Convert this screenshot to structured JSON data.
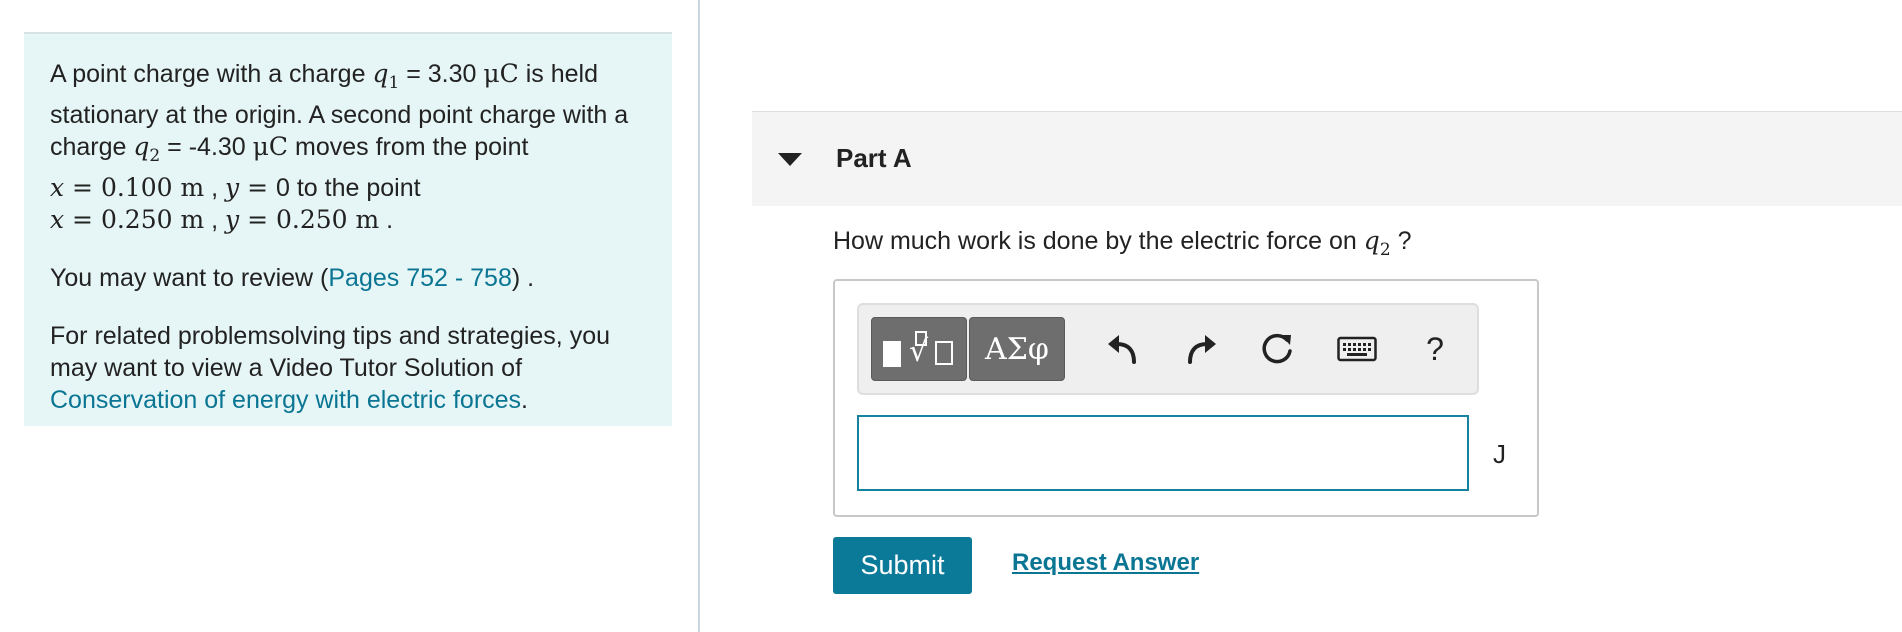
{
  "problem": {
    "p1": {
      "t1": "A point charge with a charge ",
      "q1_sym": "q",
      "q1_sub": "1",
      "t2": " = 3.30 ",
      "unit1": "μC",
      "t3": " is held stationary at the origin. A second point charge with a charge ",
      "q2_sym": "q",
      "q2_sub": "2",
      "t4": " = -4.30 ",
      "unit2": "μC",
      "t5": " moves from the point",
      "line4_x": "x",
      "line4_eq1": " = ",
      "line4_xval": "0.100 m",
      "line4_sep": " , ",
      "line4_y": "y",
      "line4_eq2": " = ",
      "line4_rest": "0 to the point",
      "line5_x": "x",
      "line5_eq1": " = ",
      "line5_xval": "0.250 m",
      "line5_sep": " , ",
      "line5_y": "y",
      "line5_eq2": " = ",
      "line5_yval": "0.250 m",
      "line5_end": " ."
    },
    "p2": {
      "pre": "You may want to review (",
      "link": "Pages 752 - 758",
      "post": ") ."
    },
    "p3": {
      "pre": "For related problemsolving tips and strategies, you may want to view a Video Tutor Solution of ",
      "link": "Conservation of energy with electric forces",
      "post": "."
    }
  },
  "part": {
    "title": "Part A",
    "question_pre": "How much work is done by the electric force on ",
    "question_sym": "q",
    "question_sub": "2",
    "question_post": " ?"
  },
  "toolbar": {
    "symbols_label": "ΑΣφ",
    "help_label": "?"
  },
  "answer": {
    "value": "",
    "unit": "J"
  },
  "actions": {
    "submit_label": "Submit",
    "request_label": "Request Answer"
  },
  "icons": {
    "caret": "caret-down-icon",
    "template": "template-icon",
    "undo": "undo-icon",
    "redo": "redo-icon",
    "reset": "reset-icon",
    "keyboard": "keyboard-icon"
  },
  "colors": {
    "accent": "#0b7a99",
    "link": "#0a7694",
    "panel_bg": "#e6f5f5"
  }
}
